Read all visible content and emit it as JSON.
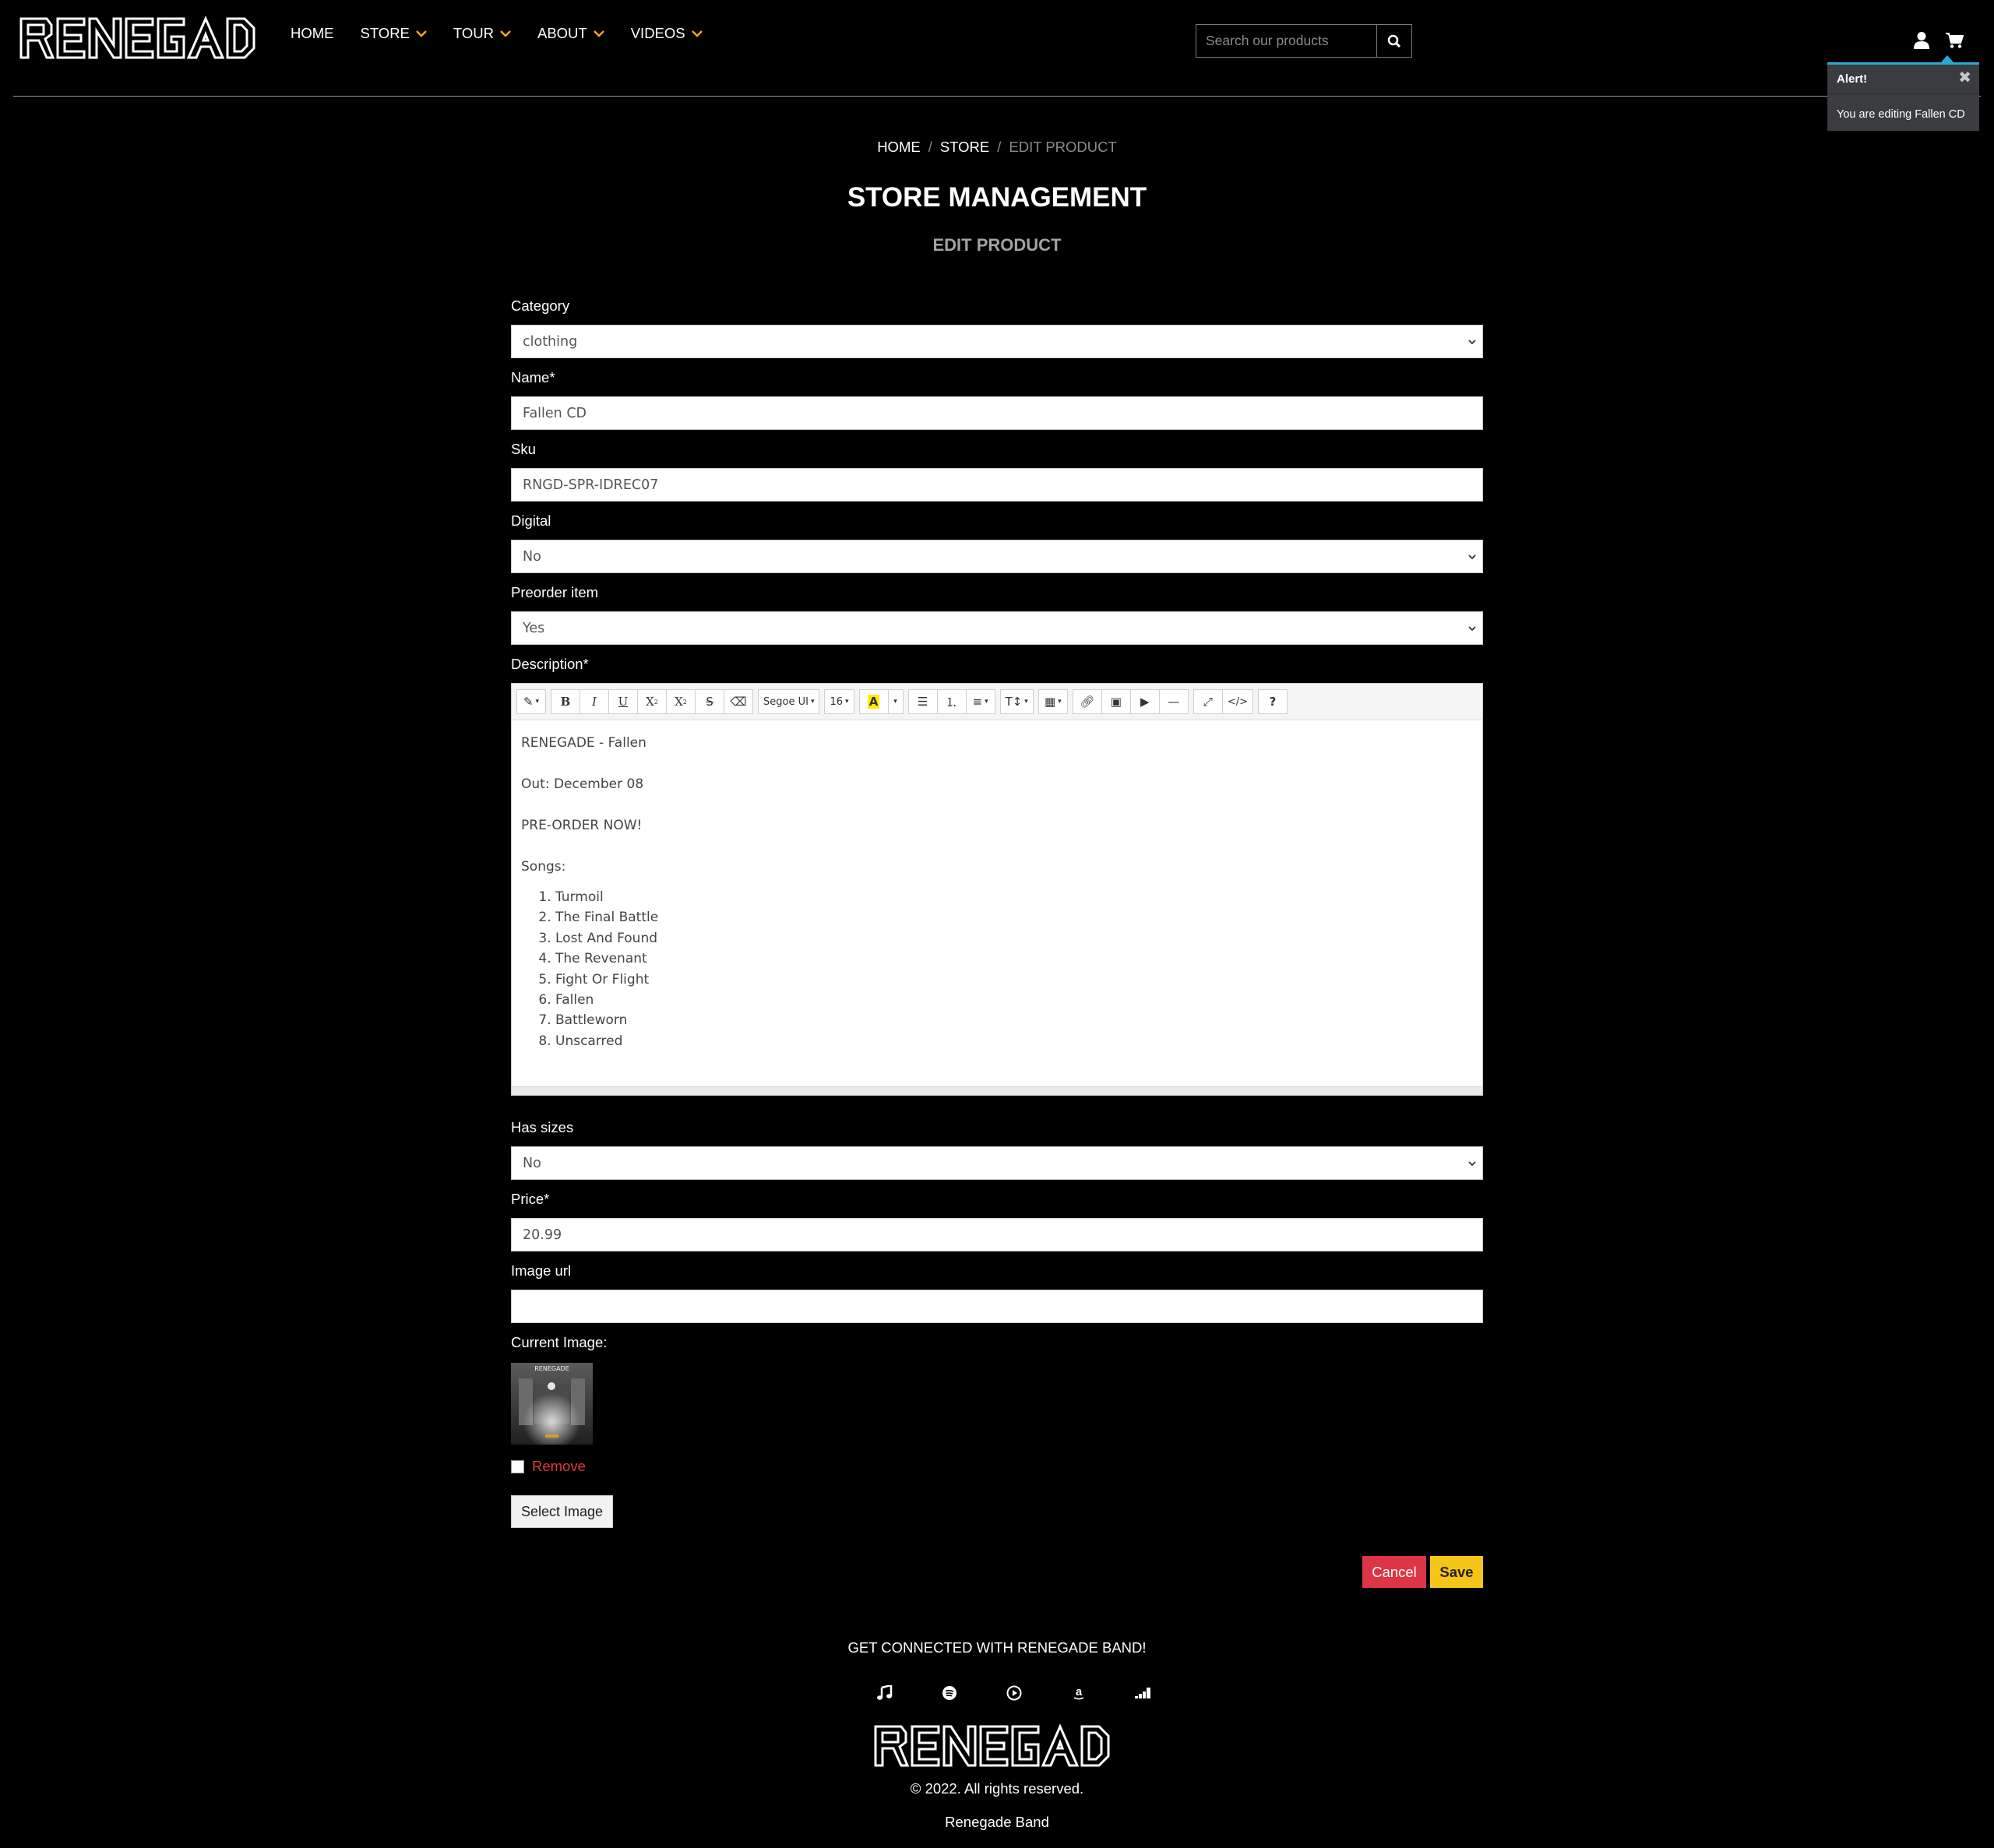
{
  "brand": {
    "logo_text": "RENEGADE"
  },
  "nav": {
    "items": [
      {
        "label": "HOME"
      },
      {
        "label": "STORE"
      },
      {
        "label": "TOUR"
      },
      {
        "label": "ABOUT"
      },
      {
        "label": "VIDEOS"
      }
    ],
    "search_placeholder": "Search our products",
    "accent_color": "#f5a623"
  },
  "alert": {
    "title": "Alert!",
    "close": "✖",
    "message": "You are editing Fallen CD"
  },
  "breadcrumb": {
    "home": "HOME",
    "store": "STORE",
    "separator": "/",
    "current": "EDIT PRODUCT"
  },
  "page": {
    "title": "STORE MANAGEMENT",
    "subtitle": "EDIT PRODUCT"
  },
  "form": {
    "category": {
      "label": "Category",
      "value": "clothing"
    },
    "name": {
      "label": "Name*",
      "value": "Fallen CD"
    },
    "sku": {
      "label": "Sku",
      "value": "RNGD-SPR-IDREC07"
    },
    "digital": {
      "label": "Digital",
      "value": "No"
    },
    "preorder": {
      "label": "Preorder item",
      "value": "Yes"
    },
    "description": {
      "label": "Description*",
      "toolbar": {
        "font_name": "Segoe UI",
        "font_size": "16"
      },
      "lines": [
        "RENEGADE - Fallen",
        "Out: December 08",
        "PRE-ORDER NOW!",
        "Songs:"
      ],
      "songs": [
        "Turmoil",
        "The Final Battle",
        "Lost And Found",
        "The Revenant",
        "Fight Or Flight",
        "Fallen",
        "Battleworn",
        "Unscarred"
      ]
    },
    "has_sizes": {
      "label": "Has sizes",
      "value": "No"
    },
    "price": {
      "label": "Price*",
      "value": "20.99"
    },
    "image_url": {
      "label": "Image url",
      "value": ""
    },
    "current_image": {
      "label": "Current Image:",
      "cover_text": "RENEGADE"
    },
    "remove_label": "Remove",
    "select_image": "Select Image",
    "cancel": "Cancel",
    "save": "Save"
  },
  "footer": {
    "heading": "GET CONNECTED WITH RENEGADE BAND!",
    "socials": [
      "music-note-icon",
      "spotify-icon",
      "youtube-music-icon",
      "amazon-icon",
      "deezer-icon"
    ],
    "logo_text": "RENEGADE",
    "copyright": "© 2022. All rights reserved.",
    "band": "Renegade Band"
  }
}
